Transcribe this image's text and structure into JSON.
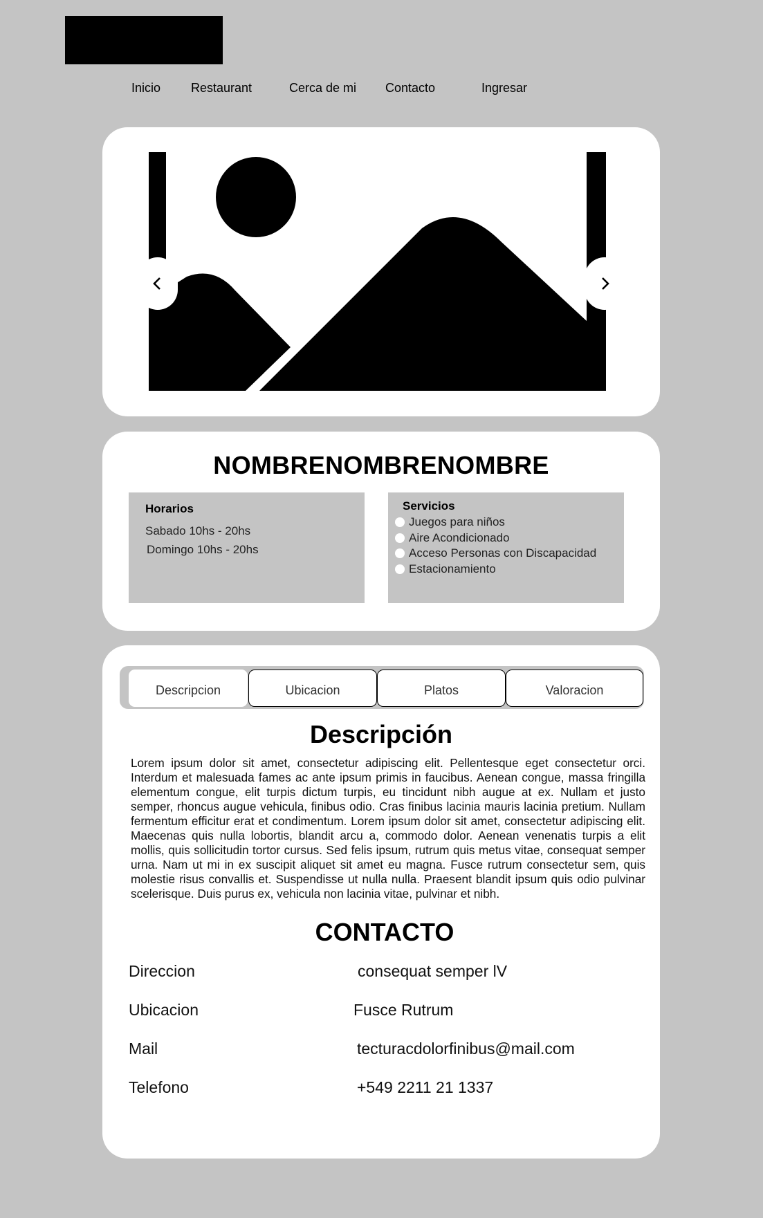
{
  "nav": {
    "items": [
      {
        "label": "Inicio"
      },
      {
        "label": "Restaurant"
      },
      {
        "label": "Cerca de mi"
      },
      {
        "label": "Contacto"
      },
      {
        "label": "Ingresar"
      }
    ]
  },
  "carousel": {
    "image_icon": "image-placeholder-icon",
    "prev_icon": "chevron-left-icon",
    "next_icon": "chevron-right-icon"
  },
  "restaurant": {
    "name": "NOMBRENOMBRENOMBRE",
    "hours": {
      "title": "Horarios",
      "lines": [
        "Sabado 10hs - 20hs",
        "Domingo 10hs - 20hs"
      ]
    },
    "services": {
      "title": "Servicios",
      "items": [
        "Juegos para niños",
        "Aire Acondicionado",
        "Acceso Personas con Discapacidad",
        "Estacionamiento"
      ]
    }
  },
  "tabs": [
    {
      "label": "Descripcion",
      "active": true
    },
    {
      "label": "Ubicacion"
    },
    {
      "label": "Platos"
    },
    {
      "label": "Valoracion"
    }
  ],
  "description": {
    "title": "Descripción",
    "text": "Lorem ipsum dolor sit amet, consectetur adipiscing elit. Pellentesque eget consectetur orci. Interdum et malesuada fames ac ante ipsum primis in faucibus. Aenean congue, massa fringilla elementum congue, elit turpis dictum turpis, eu tincidunt nibh augue at ex. Nullam et justo semper, rhoncus augue vehicula, finibus odio. Cras finibus lacinia mauris lacinia pretium. Nullam fermentum efficitur erat et condimentum. Lorem ipsum dolor sit amet, consectetur adipiscing elit. Maecenas quis nulla lobortis, blandit arcu a, commodo dolor. Aenean venenatis turpis a elit mollis, quis sollicitudin tortor cursus. Sed felis ipsum, rutrum quis metus vitae, consequat semper urna. Nam ut mi in ex suscipit aliquet sit amet eu magna. Fusce rutrum consectetur sem, quis molestie risus convallis et. Suspendisse ut nulla nulla. Praesent blandit ipsum quis odio pulvinar scelerisque. Duis purus ex, vehicula non lacinia vitae, pulvinar et nibh."
  },
  "contact": {
    "title": "CONTACTO",
    "rows": [
      {
        "label": "Direccion",
        "value": "consequat semper lV"
      },
      {
        "label": "Ubicacion",
        "value": "Fusce Rutrum"
      },
      {
        "label": "Mail",
        "value": "tecturacdolorfinibus@mail.com"
      },
      {
        "label": "Telefono",
        "value": "+549 2211 21 1337"
      }
    ]
  }
}
